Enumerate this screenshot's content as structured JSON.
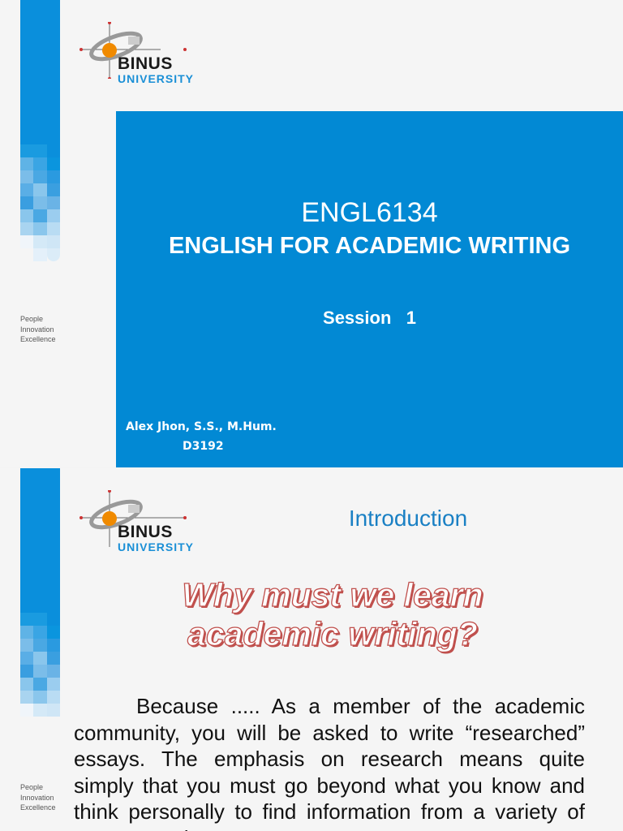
{
  "logo": {
    "name": "BINUS",
    "sub": "UNIVERSITY"
  },
  "tagline": [
    "People",
    "Innovation",
    "Excellence"
  ],
  "slide1": {
    "course_code": "ENGL6134",
    "course_title": "ENGLISH FOR ACADEMIC WRITING",
    "session": "Session   1",
    "author": "Alex Jhon, S.S., M.Hum.",
    "lecturer_id": "D3192"
  },
  "slide2": {
    "heading": "Introduction",
    "question_line1": "Why must we learn",
    "question_line2": "academic writing?",
    "body": "Because ..... As a member of the academic community, you will be asked to write “researched” essays. The emphasis on research means quite simply that you must go beyond what you know and think personally to find information from a variety of sources and"
  },
  "colors": {
    "blue": "#0289d4",
    "accent_red": "#c0504d",
    "heading_blue": "#1a80c4"
  }
}
